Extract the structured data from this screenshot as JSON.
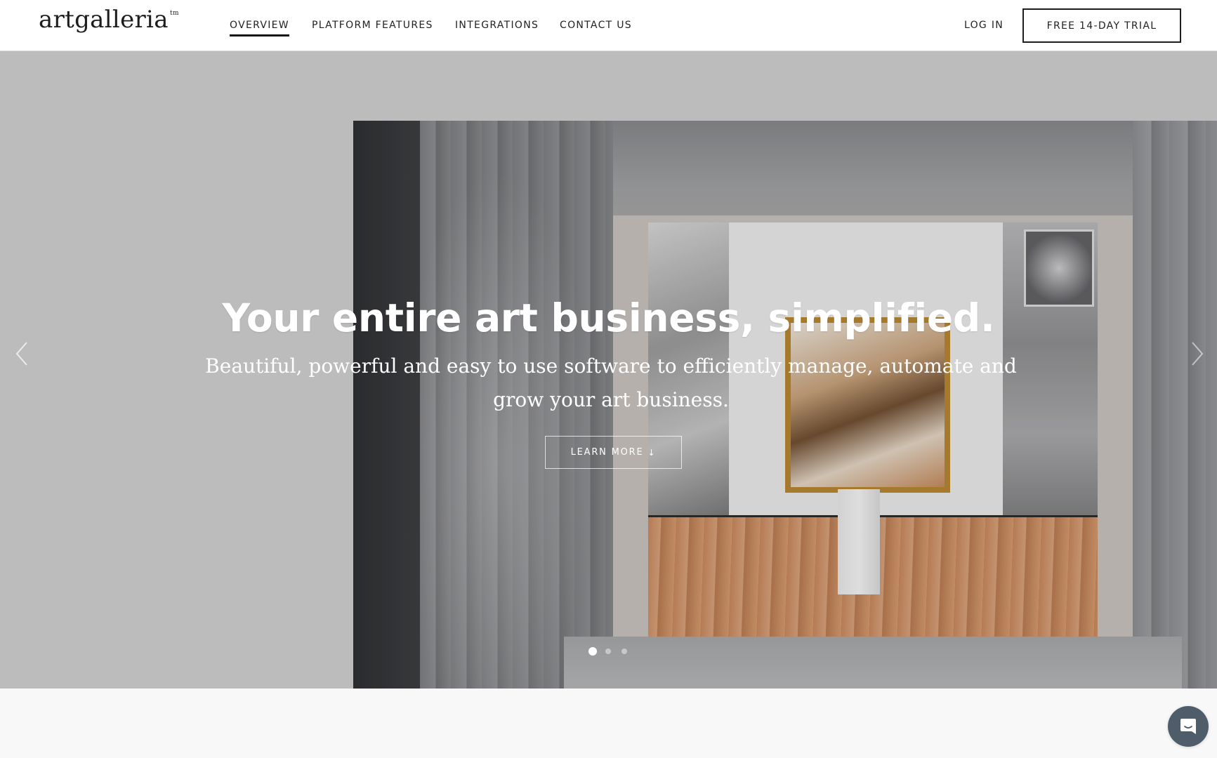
{
  "header": {
    "logo_text": "artgalleria",
    "logo_mark": "tm",
    "nav": [
      {
        "label": "OVERVIEW",
        "active": true
      },
      {
        "label": "PLATFORM FEATURES",
        "active": false
      },
      {
        "label": "INTEGRATIONS",
        "active": false
      },
      {
        "label": "CONTACT US",
        "active": false
      }
    ],
    "login_label": "LOG IN",
    "trial_label": "FREE 14-DAY TRIAL"
  },
  "hero": {
    "headline": "Your entire art business, simplified.",
    "subtitle": "Beautiful, powerful and easy to use software to efficiently manage, automate and grow your art business.",
    "cta_label": "LEARN MORE",
    "cta_icon": "arrow-down-icon",
    "cta_arrow_glyph": "↓",
    "slides_total": 3,
    "active_slide": 1,
    "prev_icon": "chevron-left-icon",
    "next_icon": "chevron-right-icon"
  },
  "chat_widget": {
    "icon": "chat-bubble-icon",
    "color": "#4f5d6b"
  },
  "colors": {
    "hero_background": "#bcbcbc",
    "page_background": "#f8f8f8",
    "text_dark": "#222222"
  }
}
